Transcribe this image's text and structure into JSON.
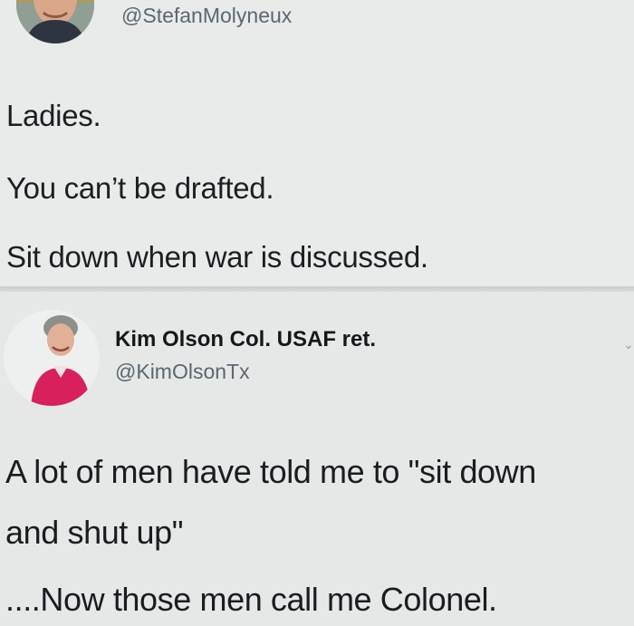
{
  "first_tweet": {
    "handle": "@StefanMolyneux",
    "lines": [
      "Ladies.",
      "You can’t be drafted.",
      "Sit down when war is discussed."
    ]
  },
  "second_tweet": {
    "display_name": "Kim Olson Col. USAF ret.",
    "handle": "@KimOlsonTx",
    "lines": [
      "A lot of men have told me to \"sit down",
      "and shut up\"",
      "....Now those men call me Colonel."
    ]
  },
  "colors": {
    "background": "#e6e9e8",
    "text": "#1c1f22",
    "handle": "#5b6770",
    "divider": "#c9cdcc"
  },
  "icons": {
    "first_avatar": "avatar-photo-man",
    "second_avatar": "avatar-photo-woman",
    "menu": "chevron-down-icon"
  }
}
